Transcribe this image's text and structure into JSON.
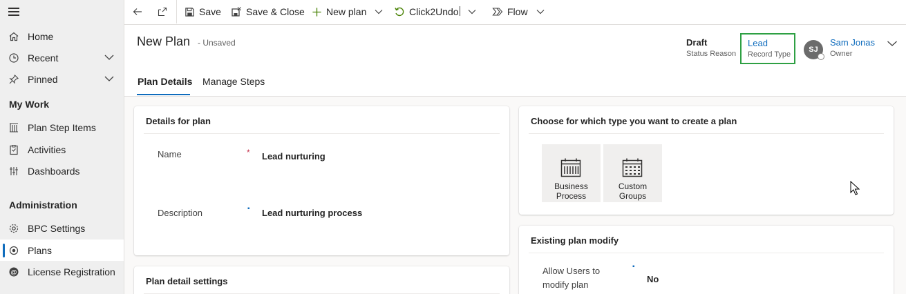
{
  "sidebar": {
    "items": [
      {
        "label": "Home",
        "icon": "home-icon"
      },
      {
        "label": "Recent",
        "icon": "clock-icon"
      },
      {
        "label": "Pinned",
        "icon": "pin-icon"
      }
    ],
    "sections": [
      {
        "title": "My Work",
        "items": [
          {
            "label": "Plan Step Items",
            "icon": "plan-step-icon"
          },
          {
            "label": "Activities",
            "icon": "clipboard-icon"
          },
          {
            "label": "Dashboards",
            "icon": "dashboard-icon"
          }
        ]
      },
      {
        "title": "Administration",
        "items": [
          {
            "label": "BPC Settings",
            "icon": "settings-gear-icon"
          },
          {
            "label": "Plans",
            "icon": "plans-icon"
          },
          {
            "label": "License Registration",
            "icon": "license-icon"
          }
        ]
      }
    ],
    "active_item": "Plans"
  },
  "commandbar": {
    "save": "Save",
    "save_close": "Save & Close",
    "new_plan": "New plan",
    "click2undo": "Click2Undo",
    "flow": "Flow"
  },
  "header": {
    "title": "New Plan",
    "subtitle": "- Unsaved",
    "status_reason": {
      "value": "Draft",
      "label": "Status Reason"
    },
    "record_type": {
      "value": "Lead",
      "label": "Record Type"
    },
    "owner": {
      "initials": "SJ",
      "name": "Sam Jonas",
      "label": "Owner"
    },
    "tabs": [
      "Plan Details",
      "Manage Steps"
    ],
    "active_tab": "Plan Details"
  },
  "details_card": {
    "title": "Details for plan",
    "fields": [
      {
        "label": "Name",
        "required_marker": "*",
        "value": "Lead nurturing"
      },
      {
        "label": "Description",
        "required_marker": "▪",
        "value": "Lead nurturing process"
      }
    ]
  },
  "settings_card": {
    "title": "Plan detail settings"
  },
  "type_card": {
    "title": "Choose for which type you want to create a plan",
    "tiles": [
      {
        "label_line1": "Business",
        "label_line2": "Process",
        "icon": "calendar-icon"
      },
      {
        "label_line1": "Custom",
        "label_line2": "Groups",
        "icon": "calendar-icon"
      }
    ]
  },
  "modify_card": {
    "title": "Existing plan modify",
    "field": {
      "label_line1": "Allow Users to",
      "label_line2": "modify plan",
      "value": "No"
    }
  },
  "colors": {
    "accent": "#0f6cbd",
    "highlight_box": "#2ea043",
    "required": "#c4314b"
  }
}
